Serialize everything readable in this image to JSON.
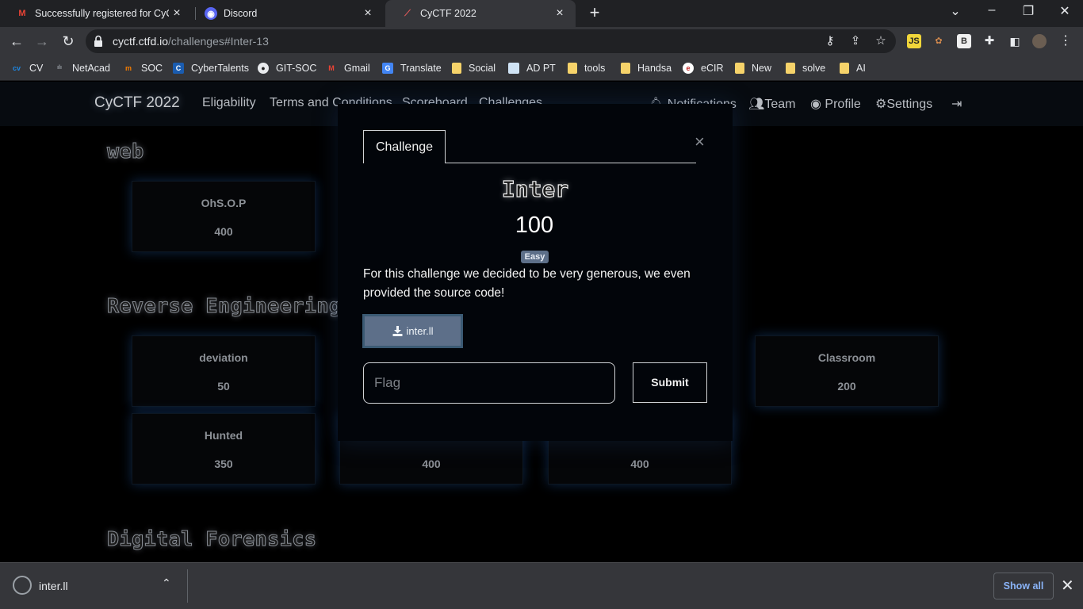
{
  "browser": {
    "tabs": [
      {
        "title": "Successfully registered for CyCTF",
        "favicon": "gmail-icon",
        "active": false
      },
      {
        "title": "Discord",
        "favicon": "discord-icon",
        "active": false
      },
      {
        "title": "CyCTF 2022",
        "favicon": "cyctf-icon",
        "active": true
      }
    ],
    "url_host": "cyctf.ctfd.io",
    "url_path": "/challenges#Inter-13",
    "bookmarks": [
      {
        "label": "CV",
        "icon": "cv-icon"
      },
      {
        "label": "NetAcad",
        "icon": "cisco-icon"
      },
      {
        "label": "SOC",
        "icon": "soc-icon"
      },
      {
        "label": "CyberTalents",
        "icon": "cybertalents-icon"
      },
      {
        "label": "GIT-SOC",
        "icon": "github-icon"
      },
      {
        "label": "Gmail",
        "icon": "gmail-icon"
      },
      {
        "label": "Translate",
        "icon": "translate-icon"
      },
      {
        "label": "Social",
        "icon": "folder-icon"
      },
      {
        "label": "AD PT",
        "icon": "page-icon"
      },
      {
        "label": "tools",
        "icon": "folder-icon"
      },
      {
        "label": "Handsa",
        "icon": "folder-icon"
      },
      {
        "label": "eCIR",
        "icon": "ecir-icon"
      },
      {
        "label": "New",
        "icon": "folder-icon"
      },
      {
        "label": "solve",
        "icon": "folder-icon"
      },
      {
        "label": "AI",
        "icon": "folder-icon"
      }
    ]
  },
  "site": {
    "brand": "CyCTF 2022",
    "nav": [
      "Eligability",
      "Terms and Conditions",
      "Scoreboard",
      "Challenges"
    ],
    "nav_right": {
      "notifications": "Notifications",
      "team": "Team",
      "profile": "Profile",
      "settings": "Settings"
    }
  },
  "sections": {
    "web": "web",
    "reverse": "Reverse Engineering",
    "forensics": "Digital Forensics"
  },
  "cards": {
    "web_1": {
      "name": "OhS.O.P",
      "value": "400"
    },
    "re_1": {
      "name": "deviation",
      "value": "50"
    },
    "re_4": {
      "name": "Classroom",
      "value": "200"
    },
    "re_5": {
      "name": "Hunted",
      "value": "350"
    },
    "re_6": {
      "name": "",
      "value": "400"
    },
    "re_7": {
      "name": "",
      "value": "400"
    }
  },
  "modal": {
    "tab": "Challenge",
    "title": "Inter",
    "value": "100",
    "difficulty": "Easy",
    "description": "For this challenge we decided to be very generous, we even provided the source code!",
    "file": "inter.ll",
    "flag_placeholder": "Flag",
    "submit": "Submit"
  },
  "downloads": {
    "file": "inter.ll",
    "show_all": "Show all"
  }
}
